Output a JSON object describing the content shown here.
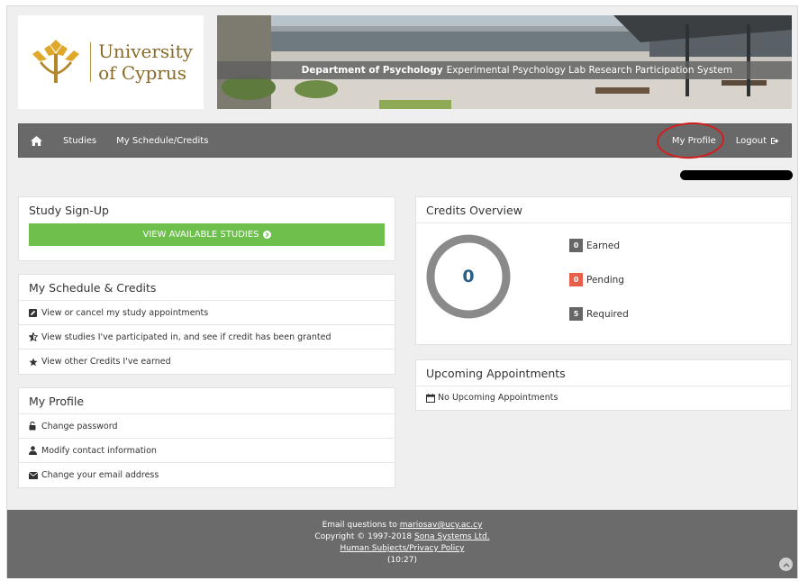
{
  "header": {
    "logo_line1": "University",
    "logo_line2": "of Cyprus",
    "banner_dept": "Department of Psychology",
    "banner_system": "Experimental Psychology Lab Research Participation System"
  },
  "navbar": {
    "home_icon": "home-icon",
    "items": [
      {
        "label": "Studies"
      },
      {
        "label": "My Schedule/Credits"
      }
    ],
    "profile_label": "My Profile",
    "logout_label": "Logout",
    "logout_icon": "sign-out-icon"
  },
  "study_signup": {
    "title": "Study Sign-Up",
    "button_label": "VIEW AVAILABLE STUDIES"
  },
  "schedule_credits": {
    "title": "My Schedule & Credits",
    "items": [
      {
        "label": "View or cancel my study appointments",
        "icon": "edit-icon"
      },
      {
        "label": "View studies I've participated in, and see if credit has been granted",
        "icon": "star-half-icon"
      },
      {
        "label": "View other Credits I've earned",
        "icon": "star-icon"
      }
    ]
  },
  "my_profile": {
    "title": "My Profile",
    "items": [
      {
        "label": "Change password",
        "icon": "lock-icon"
      },
      {
        "label": "Modify contact information",
        "icon": "user-icon"
      },
      {
        "label": "Change your email address",
        "icon": "envelope-icon"
      }
    ]
  },
  "credits_overview": {
    "title": "Credits Overview",
    "total": "0",
    "rows": [
      {
        "count": "0",
        "label": "Earned",
        "color": "#666666"
      },
      {
        "count": "0",
        "label": "Pending",
        "color": "#e8604c"
      },
      {
        "count": "5",
        "label": "Required",
        "color": "#666666"
      }
    ]
  },
  "upcoming": {
    "title": "Upcoming Appointments",
    "empty_text": "No Upcoming Appointments",
    "icon": "calendar-icon"
  },
  "footer": {
    "email_prefix": "Email questions to",
    "email": "mariosav@ucy.ac.cy",
    "copyright_prefix": "Copyright © 1997-2018",
    "company": "Sona Systems Ltd.",
    "policy": "Human Subjects/Privacy Policy",
    "time": "(10:27)"
  },
  "colors": {
    "navbar": "#696969",
    "button_green": "#6dc04b",
    "badge_pending": "#e8604c",
    "badge_default": "#666666",
    "donut_ring": "#8a8a8a",
    "donut_value": "#2c5f85",
    "logo_gold": "#b99640"
  }
}
